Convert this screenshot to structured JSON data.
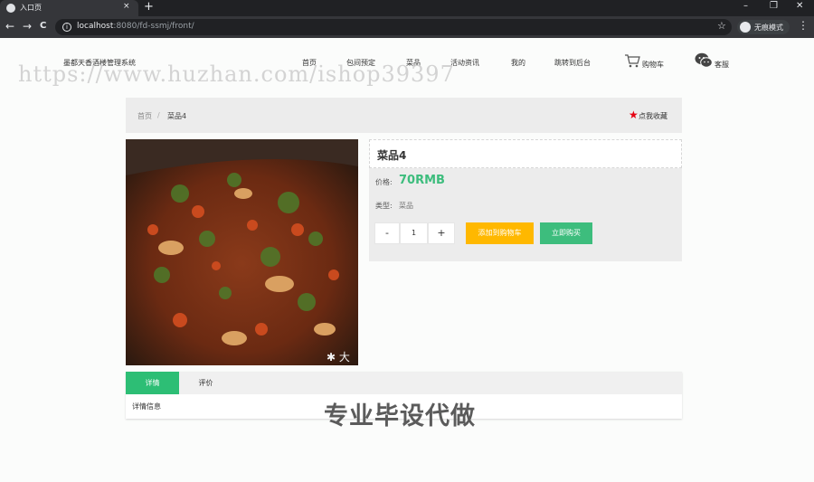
{
  "browser": {
    "tab_title": "入口页",
    "tab_close": "×",
    "new_tab": "+",
    "minimize": "–",
    "restore": "❐",
    "close": "✕",
    "back": "←",
    "forward": "→",
    "reload": "C",
    "url_host": "localhost",
    "url_rest": ":8080/fd-ssmj/front/",
    "incognito_label": "无痕模式",
    "menu": "⋮"
  },
  "site": {
    "title": "墨都天香酒楼管理系统",
    "watermark": "https://www.huzhan.com/ishop39397",
    "nav": [
      "首页",
      "包间预定",
      "菜品",
      "活动资讯",
      "我的",
      "跳转到后台"
    ],
    "cart_label": "购物车",
    "service_label": "客服"
  },
  "breadcrumb": {
    "home": "首页",
    "separator": "/",
    "current": "菜品4",
    "favorite_label": "点我收藏"
  },
  "product": {
    "name": "菜品4",
    "price_label": "价格:",
    "price_value": "70RMB",
    "type_label": "类型:",
    "type_value": "菜品",
    "qty_minus": "-",
    "qty_value": "1",
    "qty_plus": "+",
    "add_to_cart": "添加到购物车",
    "buy_now": "立即购买"
  },
  "detail": {
    "tabs": [
      "详情",
      "评价"
    ],
    "content": "详情信息"
  },
  "promo_overlay": "专业毕设代做",
  "colors": {
    "accent_green": "#2dbe75",
    "price_green": "#3dbd7d",
    "cart_yellow": "#ffb800",
    "favorite_red": "#e60012"
  }
}
